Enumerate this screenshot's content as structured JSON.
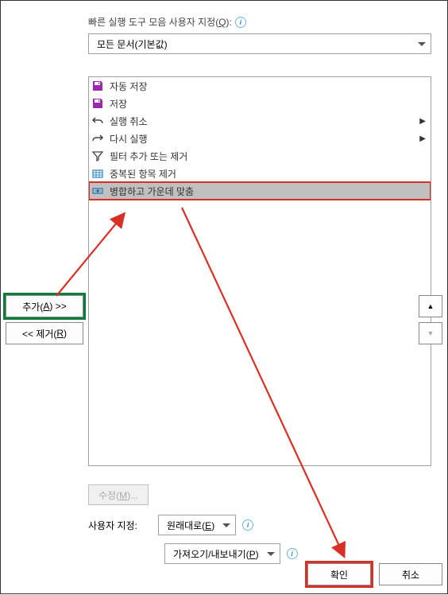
{
  "header": {
    "label_prefix": "빠른 실행 도구 모음 사용자 지정(",
    "label_key": "Q",
    "label_suffix": "):"
  },
  "scope_dropdown": {
    "value": "모든 문서(기본값)"
  },
  "list_items": [
    {
      "icon": "save-icon",
      "label": "자동 저장",
      "expandable": false
    },
    {
      "icon": "save-icon",
      "label": "저장",
      "expandable": false
    },
    {
      "icon": "undo-icon",
      "label": "실행 취소",
      "expandable": true
    },
    {
      "icon": "redo-icon",
      "label": "다시 실행",
      "expandable": true
    },
    {
      "icon": "filter-icon",
      "label": "필터 추가 또는 제거",
      "expandable": false
    },
    {
      "icon": "dedup-icon",
      "label": "중복된 항목 제거",
      "expandable": false
    },
    {
      "icon": "merge-icon",
      "label": "병합하고 가운데 맞춤",
      "expandable": false,
      "selected": true
    }
  ],
  "side": {
    "add_prefix": "추가(",
    "add_key": "A",
    "add_suffix": ") >>",
    "remove_prefix": "<< 제거(",
    "remove_key": "R",
    "remove_suffix": ")"
  },
  "updown": {
    "up": "▲",
    "down": "▼"
  },
  "modify": {
    "prefix": "수정(",
    "key": "M",
    "suffix": ")..."
  },
  "customize": {
    "label": "사용자 지정:",
    "reset_prefix": "원래대로(",
    "reset_key": "E",
    "reset_suffix": ")"
  },
  "import": {
    "prefix": "가져오기/내보내기(",
    "key": "P",
    "suffix": ")"
  },
  "footer": {
    "ok": "확인",
    "cancel": "취소"
  }
}
